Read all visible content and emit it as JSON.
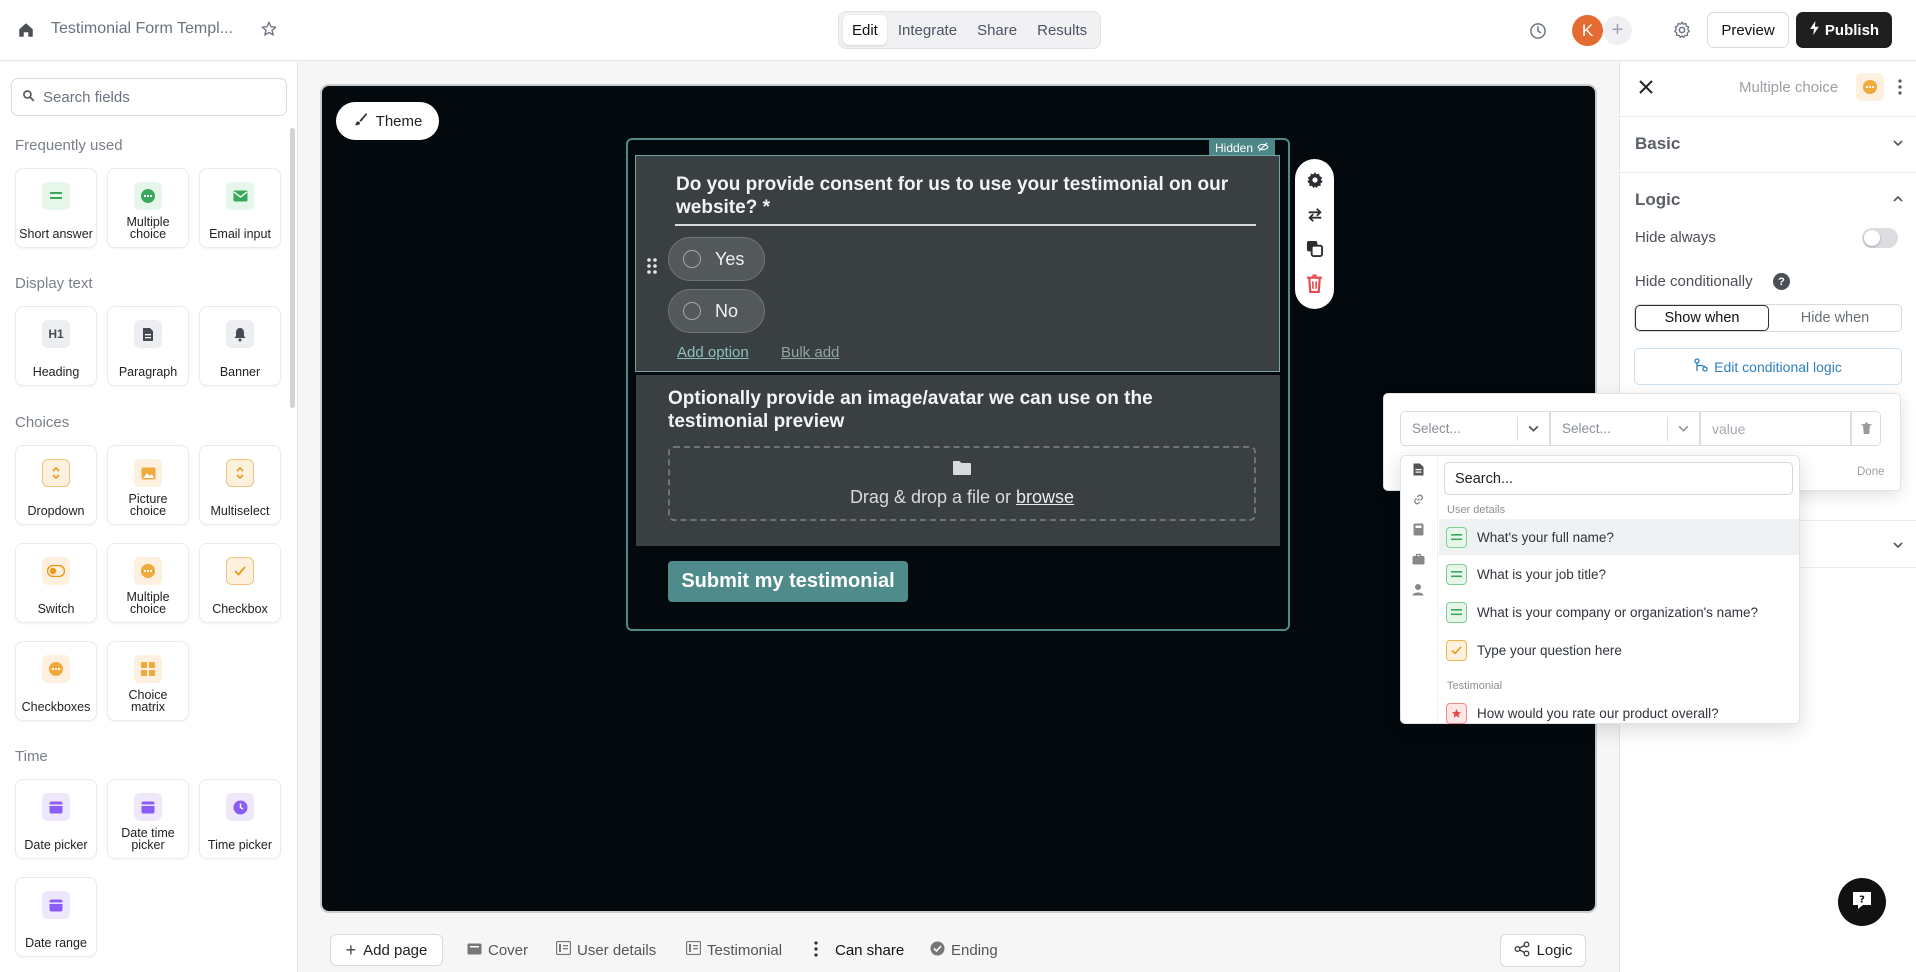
{
  "header": {
    "form_title": "Testimonial Form Templ...",
    "tabs": [
      {
        "label": "Edit",
        "active": true
      },
      {
        "label": "Integrate",
        "active": false
      },
      {
        "label": "Share",
        "active": false
      },
      {
        "label": "Results",
        "active": false
      }
    ],
    "avatar_initial": "K",
    "add_collaborator": "+",
    "preview_label": "Preview",
    "publish_label": "Publish"
  },
  "sidebar": {
    "search_placeholder": "Search fields",
    "sections": {
      "frequently_used": "Frequently used",
      "display_text": "Display text",
      "choices": "Choices",
      "time": "Time"
    },
    "frequently_used": [
      {
        "label": "Short answer",
        "icon": "short-answer-icon"
      },
      {
        "label": "Multiple choice",
        "icon": "multiple-choice-icon"
      },
      {
        "label": "Email input",
        "icon": "email-icon"
      }
    ],
    "display_text": [
      {
        "label": "Heading",
        "icon": "heading-icon",
        "glyph": "H1"
      },
      {
        "label": "Paragraph",
        "icon": "paragraph-icon"
      },
      {
        "label": "Banner",
        "icon": "bell-icon"
      }
    ],
    "choices": [
      {
        "label": "Dropdown",
        "icon": "dropdown-icon"
      },
      {
        "label": "Picture choice",
        "icon": "picture-icon"
      },
      {
        "label": "Multiselect",
        "icon": "multiselect-icon"
      },
      {
        "label": "Switch",
        "icon": "switch-icon"
      },
      {
        "label": "Multiple choice",
        "icon": "multiple-choice-icon"
      },
      {
        "label": "Checkbox",
        "icon": "checkbox-icon"
      },
      {
        "label": "Checkboxes",
        "icon": "checkboxes-icon"
      },
      {
        "label": "Choice matrix",
        "icon": "matrix-icon"
      }
    ],
    "time": [
      {
        "label": "Date picker",
        "icon": "calendar-icon"
      },
      {
        "label": "Date time picker",
        "icon": "calendar-icon"
      },
      {
        "label": "Time picker",
        "icon": "clock-icon"
      },
      {
        "label": "Date range",
        "icon": "calendar-icon"
      }
    ]
  },
  "canvas": {
    "theme_label": "Theme",
    "hidden_badge": "Hidden",
    "question1": {
      "title": "Do you provide consent for us to use your testimonial on our website? *",
      "options": [
        "Yes",
        "No"
      ],
      "add_option": "Add option",
      "bulk_add": "Bulk add"
    },
    "question2": {
      "title": "Optionally provide an image/avatar we can use on the testimonial preview",
      "dropzone_text": "Drag & drop a file or",
      "browse": "browse"
    },
    "submit_label": "Submit my testimonial",
    "background_color": "#03090d",
    "accent_color": "#4f8b8a"
  },
  "bottom_bar": {
    "add_page": "Add page",
    "pages": [
      {
        "label": "Cover",
        "icon": "cover-icon"
      },
      {
        "label": "User details",
        "icon": "page-icon"
      },
      {
        "label": "Testimonial",
        "icon": "page-icon"
      },
      {
        "label": "Can share",
        "icon": "more-vertical-icon",
        "active": true
      },
      {
        "label": "Ending",
        "icon": "check-circle-icon"
      }
    ],
    "logic_label": "Logic"
  },
  "right_panel": {
    "field_type": "Multiple choice",
    "basic": "Basic",
    "logic": "Logic",
    "hide_always": "Hide always",
    "hide_always_on": false,
    "hide_conditionally": "Hide conditionally",
    "help": "?",
    "show_when": "Show when",
    "hide_when": "Hide when",
    "edit_conditional_logic": "Edit conditional logic"
  },
  "logic_popover": {
    "field_select": "Select...",
    "operator_select": "Select...",
    "value_placeholder": "value",
    "done": "Done",
    "search_placeholder": "Search...",
    "groups": [
      {
        "name": "User details",
        "items": [
          {
            "label": "What's your full name?",
            "type": "green",
            "highlighted": true
          },
          {
            "label": "What is your job title?",
            "type": "green"
          },
          {
            "label": "What is your company or organization's name?",
            "type": "green"
          },
          {
            "label": "Type your question here",
            "type": "orange"
          }
        ]
      },
      {
        "name": "Testimonial",
        "items": [
          {
            "label": "How would you rate our product overall?",
            "type": "red"
          }
        ]
      }
    ]
  }
}
